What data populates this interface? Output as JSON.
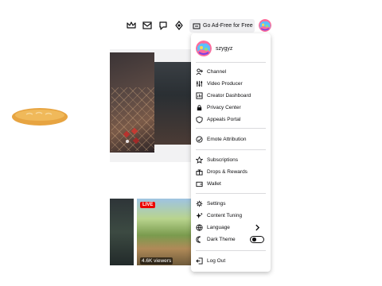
{
  "topbar": {
    "ad_free_label": "Go Ad-Free for Free",
    "icons": [
      "crown-icon",
      "inbox-icon",
      "whispers-icon",
      "notifications-icon",
      "ad-free-icon"
    ]
  },
  "menu": {
    "username": "szygyz",
    "sections": [
      [
        {
          "name": "channel",
          "label": "Channel",
          "icon": "channel-icon"
        },
        {
          "name": "video-producer",
          "label": "Video Producer",
          "icon": "video-producer-icon"
        },
        {
          "name": "creator-dashboard",
          "label": "Creator Dashboard",
          "icon": "dashboard-icon"
        },
        {
          "name": "privacy-center",
          "label": "Privacy Center",
          "icon": "lock-icon"
        },
        {
          "name": "appeals-portal",
          "label": "Appeals Portal",
          "icon": "shield-icon"
        }
      ],
      [
        {
          "name": "emote-attribution",
          "label": "Emote Attribution",
          "icon": "emote-icon"
        }
      ],
      [
        {
          "name": "subscriptions",
          "label": "Subscriptions",
          "icon": "star-icon"
        },
        {
          "name": "drops-rewards",
          "label": "Drops & Rewards",
          "icon": "gift-icon"
        },
        {
          "name": "wallet",
          "label": "Wallet",
          "icon": "wallet-icon"
        }
      ],
      [
        {
          "name": "settings",
          "label": "Settings",
          "icon": "gear-icon"
        },
        {
          "name": "content-tuning",
          "label": "Content Tuning",
          "icon": "sparkle-icon"
        },
        {
          "name": "language",
          "label": "Language",
          "icon": "globe-icon"
        },
        {
          "name": "dark-theme",
          "label": "Dark Theme",
          "icon": "moon-icon",
          "toggle_on": false
        }
      ],
      [
        {
          "name": "log-out",
          "label": "Log Out",
          "icon": "logout-icon"
        }
      ]
    ]
  },
  "content": {
    "live_badge": "LIVE",
    "viewers": "4.6K viewers"
  },
  "colors": {
    "live_red": "#eb0400",
    "text": "#0e0e10",
    "accent_purple": "#9147ff"
  }
}
